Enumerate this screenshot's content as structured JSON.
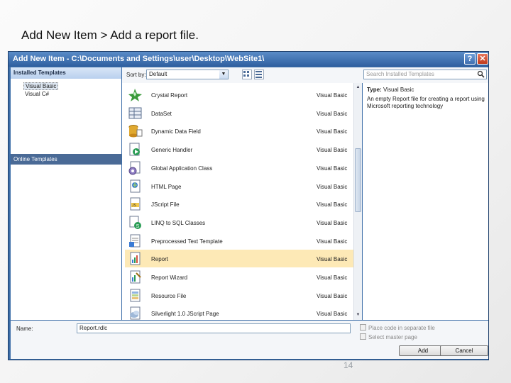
{
  "slide": {
    "title": "Add New Item > Add a report file.",
    "page_number": "14"
  },
  "dialog": {
    "title": "Add New Item - C:\\Documents and Settings\\user\\Desktop\\WebSite1\\",
    "help_label": "?",
    "close_label": "✕",
    "left_pane": {
      "header": "Installed Templates",
      "items": [
        "Visual Basic",
        "Visual C#"
      ],
      "online": "Online Templates"
    },
    "toolbar": {
      "sort_label": "Sort by:",
      "sort_value": "Default",
      "search_placeholder": "Search Installed Templates"
    },
    "templates": [
      {
        "name": "Crystal Report",
        "lang": "Visual Basic",
        "icon": "crystal-report-icon"
      },
      {
        "name": "DataSet",
        "lang": "Visual Basic",
        "icon": "dataset-icon"
      },
      {
        "name": "Dynamic Data Field",
        "lang": "Visual Basic",
        "icon": "dynamic-data-field-icon"
      },
      {
        "name": "Generic Handler",
        "lang": "Visual Basic",
        "icon": "generic-handler-icon"
      },
      {
        "name": "Global Application Class",
        "lang": "Visual Basic",
        "icon": "global-application-class-icon"
      },
      {
        "name": "HTML Page",
        "lang": "Visual Basic",
        "icon": "html-page-icon"
      },
      {
        "name": "JScript File",
        "lang": "Visual Basic",
        "icon": "jscript-file-icon"
      },
      {
        "name": "LINQ to SQL Classes",
        "lang": "Visual Basic",
        "icon": "linq-to-sql-icon"
      },
      {
        "name": "Preprocessed Text Template",
        "lang": "Visual Basic",
        "icon": "text-template-icon"
      },
      {
        "name": "Report",
        "lang": "Visual Basic",
        "icon": "report-icon"
      },
      {
        "name": "Report Wizard",
        "lang": "Visual Basic",
        "icon": "report-wizard-icon"
      },
      {
        "name": "Resource File",
        "lang": "Visual Basic",
        "icon": "resource-file-icon"
      },
      {
        "name": "Silverlight 1.0 JScript Page",
        "lang": "Visual Basic",
        "icon": "silverlight-page-icon"
      }
    ],
    "selected_index": 9,
    "details": {
      "type_label": "Type:",
      "type_value": "Visual Basic",
      "description": "An empty Report file for creating a report using Microsoft reporting technology"
    },
    "bottom": {
      "name_label": "Name:",
      "name_value": "Report.rdlc",
      "opt_separate": "Place code in separate file",
      "opt_master": "Select master page",
      "add_label": "Add",
      "cancel_label": "Cancel"
    }
  }
}
